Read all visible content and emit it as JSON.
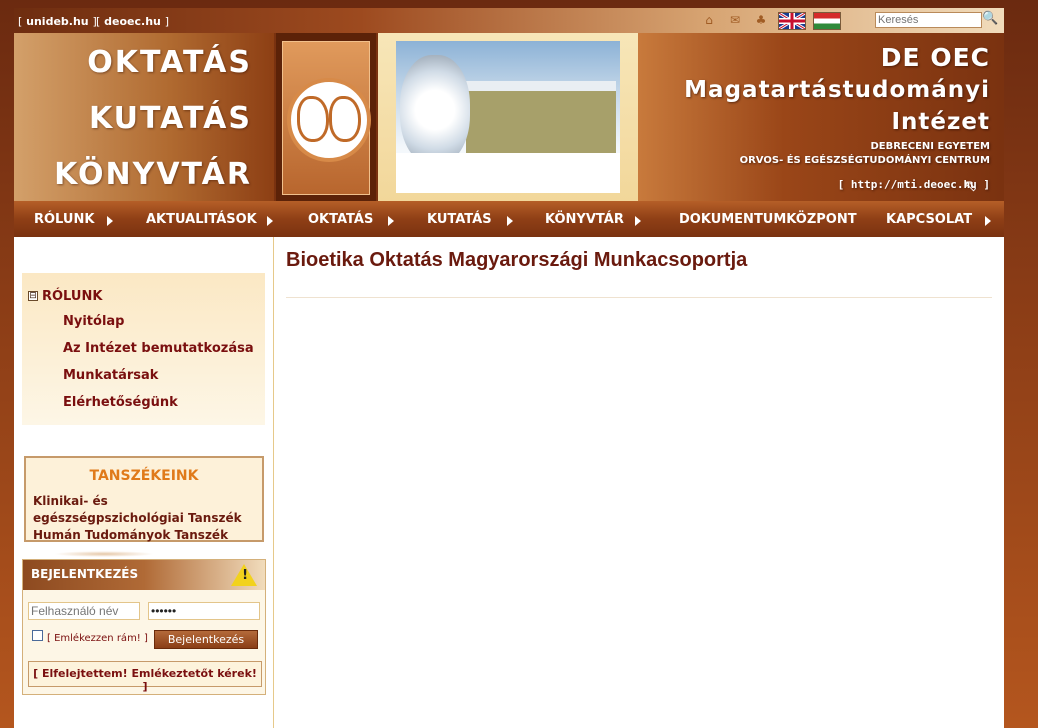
{
  "topbar": {
    "link1": "unideb.hu",
    "link2": "deoec.hu",
    "bracket_open": "[",
    "bracket_close": "]",
    "search_placeholder": "Keresés",
    "icons": [
      "home-icon",
      "mail-icon",
      "sitemap-icon",
      "search-icon"
    ]
  },
  "banner": {
    "left_words": [
      "OKTATÁS",
      "KUTATÁS",
      "KÖNYVTÁR"
    ],
    "right_line1": "DE OEC",
    "right_line2": "Magatartástudományi",
    "right_line3": "Intézet",
    "right_line4": "DEBRECENI EGYETEM",
    "right_line5": "ORVOS- ÉS EGÉSZSÉGTUDOMÁNYI CENTRUM",
    "right_url": "[ http://mti.deoec.hu ]"
  },
  "nav": {
    "items": [
      "RÓLUNK",
      "AKTUALITÁSOK",
      "OKTATÁS",
      "KUTATÁS",
      "KÖNYVTÁR",
      "DOKUMENTUMKÖZPONT",
      "KAPCSOLAT"
    ]
  },
  "main": {
    "title": "Bioetika Oktatás Magyarországi Munkacsoportja"
  },
  "sidebar": {
    "menu_title": "RÓLUNK",
    "menu_toggle": "⊟",
    "items": [
      "Nyitólap",
      "Az Intézet bemutatkozása",
      "Munkatársak",
      "Elérhetőségünk"
    ],
    "dept_title": "TANSZÉKEINK",
    "dept_text": "Klinikai- és egészségpszichológiai Tanszék Humán Tudományok Tanszék"
  },
  "login": {
    "title": "BEJELENTKEZÉS",
    "username_placeholder": "Felhasználó név",
    "password_value": "••••••",
    "remember_label": "[ Emlékezzen rám! ]",
    "submit_label": "Bejelentkezés",
    "forgot_label": "[ Elfelejtettem! Emlékeztetőt kérek! ]"
  },
  "colors": {
    "accent": "#7a0f0f",
    "brand_brown": "#8f3f16",
    "dept_title": "#e07a1a"
  }
}
